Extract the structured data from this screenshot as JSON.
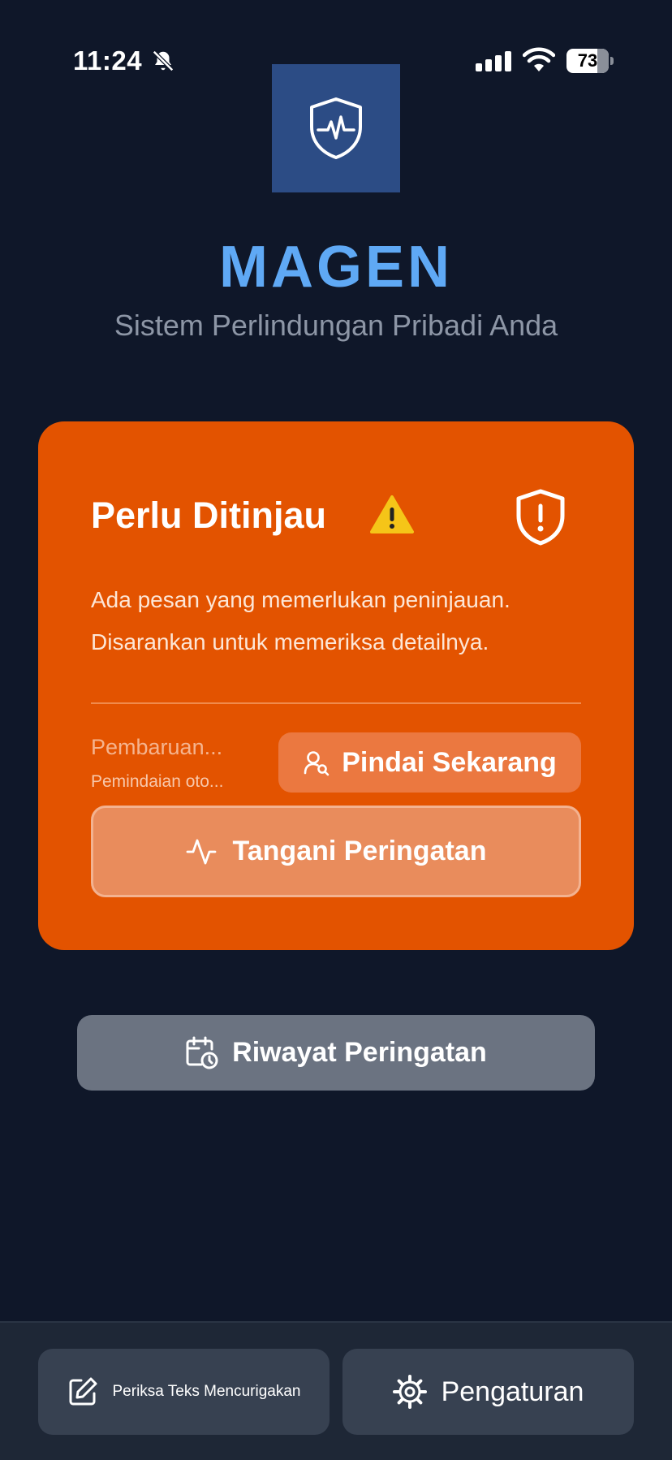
{
  "status_bar": {
    "time": "11:24",
    "battery_level": 73,
    "icons": [
      "bell-slash-icon",
      "cellular-signal-icon",
      "wifi-icon",
      "battery-icon"
    ]
  },
  "header": {
    "logo_icon": "shield-heartbeat-icon",
    "title": "MAGEN",
    "subtitle": "Sistem Perlindungan Pribadi Anda"
  },
  "status_card": {
    "title": "Perlu Ditinjau",
    "title_icon": "warning-icon",
    "corner_icon": "shield-alert-icon",
    "message_line1": "Ada pesan yang memerlukan peninjauan.",
    "message_line2": "Disarankan untuk memeriksa detailnya.",
    "update_label": "Pembaruan...",
    "auto_scan_label": "Pemindaian oto...",
    "scan_button_label": "Pindai Sekarang",
    "scan_button_icon": "user-search-icon",
    "handle_button_label": "Tangani Peringatan",
    "handle_button_icon": "activity-icon"
  },
  "history_button": {
    "label": "Riwayat Peringatan",
    "icon": "calendar-clock-icon"
  },
  "bottom_bar": {
    "check_text_label": "Periksa Teks Mencurigakan",
    "check_text_icon": "edit-icon",
    "settings_label": "Pengaturan",
    "settings_icon": "gear-icon"
  },
  "colors": {
    "background": "#0f1729",
    "title_blue": "#5fa9f5",
    "card_orange": "#e35300",
    "history_gray": "#6b7381",
    "bottom_button": "#374151"
  }
}
